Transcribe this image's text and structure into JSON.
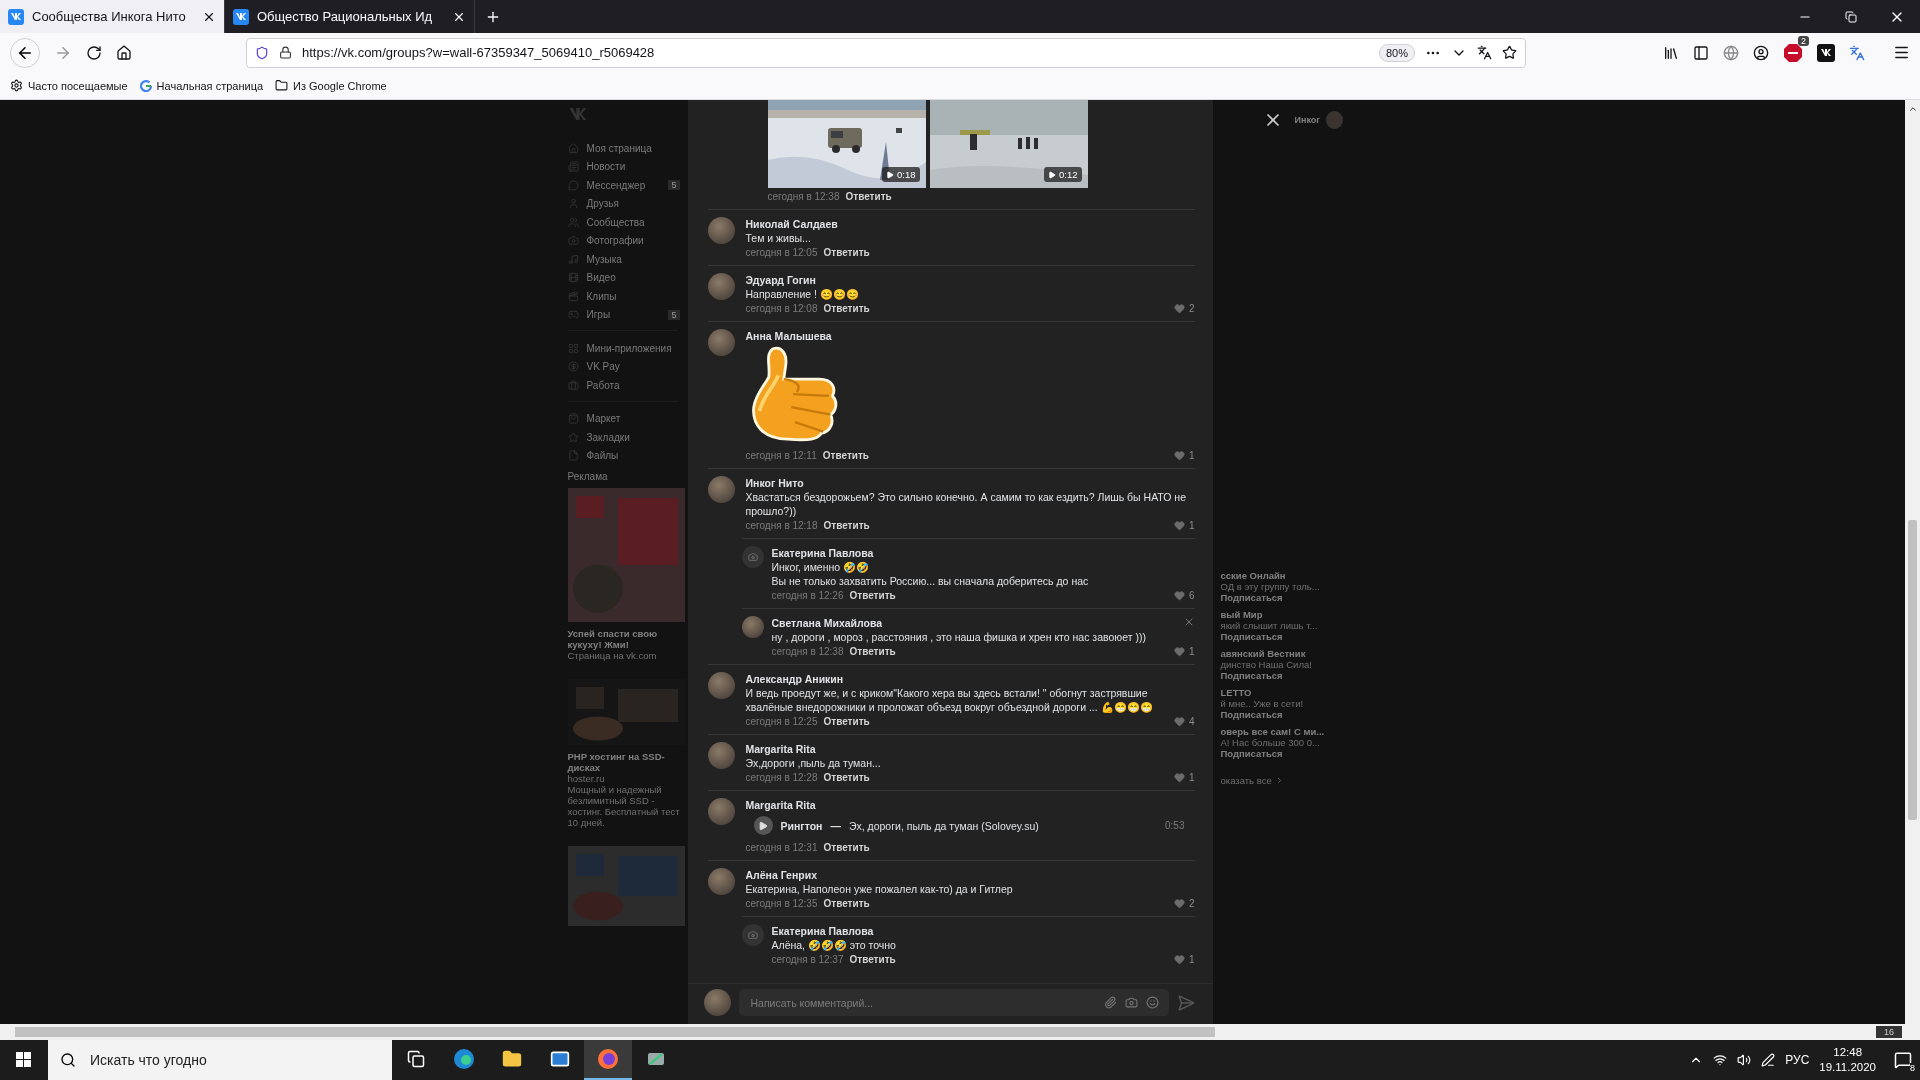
{
  "browser": {
    "tabs": [
      {
        "title": "Сообщества Инкога Нито",
        "selected": true
      },
      {
        "title": "Общество Рациональных Ид",
        "selected": false
      }
    ],
    "address": "https://vk.com/groups?w=wall-67359347_5069410_r5069428",
    "zoom": "80%",
    "adblock_badge": "2",
    "bookmarks": [
      {
        "label": "Часто посещаемые",
        "kind": "gear"
      },
      {
        "label": "Начальная страница",
        "kind": "google"
      },
      {
        "label": "Из Google Chrome",
        "kind": "folder"
      }
    ]
  },
  "sidebar": {
    "groups": [
      [
        {
          "label": "Моя страница",
          "kind": "home"
        },
        {
          "label": "Новости",
          "kind": "news"
        },
        {
          "label": "Мессенджер",
          "kind": "chat",
          "count": "5"
        },
        {
          "label": "Друзья",
          "kind": "user"
        },
        {
          "label": "Сообщества",
          "kind": "users"
        },
        {
          "label": "Фотографии",
          "kind": "camera"
        },
        {
          "label": "Музыка",
          "kind": "music"
        },
        {
          "label": "Видео",
          "kind": "video"
        },
        {
          "label": "Клипы",
          "kind": "clips"
        },
        {
          "label": "Игры",
          "kind": "games",
          "count": "5"
        }
      ],
      [
        {
          "label": "Мини-приложения",
          "kind": "apps"
        },
        {
          "label": "VK Pay",
          "kind": "pay"
        },
        {
          "label": "Работа",
          "kind": "work"
        }
      ],
      [
        {
          "label": "Маркет",
          "kind": "market"
        },
        {
          "label": "Закладки",
          "kind": "star"
        },
        {
          "label": "Файлы",
          "kind": "file"
        }
      ]
    ],
    "ads_heading": "Реклама",
    "ads": [
      {
        "kind": "picture",
        "title": "Успей спасти свою кукуху! Жми!",
        "source": "Страница на vk.com"
      },
      {
        "kind": "picture",
        "title": "PHP хостинг на SSD-дисках",
        "source": "hoster.ru",
        "description": "Мощный и надежный безлимитный SSD - хостинг. Бесплатный тест 10 дней."
      },
      {
        "kind": "picture"
      }
    ]
  },
  "right_column": {
    "user": "Инког",
    "communities": [
      {
        "name": "сские Онлайн",
        "subtitle": "ОД в эту группу толь...",
        "action": "Подписаться"
      },
      {
        "name": "вый Мир",
        "subtitle": "який слышит лишь т...",
        "action": "Подписаться"
      },
      {
        "name": "авянский Вестник",
        "subtitle": "динство Наша Сила!",
        "action": "Подписаться"
      },
      {
        "name": "LETTO",
        "subtitle": "й мне.. Уже в сети!",
        "action": "Подписаться"
      },
      {
        "name": "оверь все сам! С ми...",
        "subtitle": "А! Нас больше 300 0...",
        "action": "Подписаться"
      }
    ],
    "show_all": "оказать все"
  },
  "modal": {
    "cut_reply": {
      "videos": [
        {
          "duration": "0:18"
        },
        {
          "duration": "0:12"
        }
      ],
      "time": "сегодня в 12:38",
      "reply_label": "Ответить"
    },
    "comments": [
      {
        "author": "Николай Салдаев",
        "has_photo": true,
        "hovered": false,
        "kind": "text",
        "text": "Тем и живы...",
        "time": "сегодня в 12:05",
        "reply_label": "Ответить"
      },
      {
        "author": "Эдуард Гогин",
        "has_photo": true,
        "hovered": false,
        "kind": "text",
        "text": "Направление ! 😊😊😊",
        "time": "сегодня в 12:08",
        "reply_label": "Ответить",
        "likes": "2"
      },
      {
        "author": "Анна Малышева",
        "has_photo": true,
        "hovered": false,
        "kind": "sticker",
        "time": "сегодня в 12:11",
        "reply_label": "Ответить",
        "likes": "1"
      },
      {
        "author": "Инког Нито",
        "has_photo": true,
        "hovered": false,
        "kind": "text",
        "text": "Хвастаться бездорожьем? Это сильно конечно. А самим то как ездить? Лишь бы НАТО не прошло?))",
        "time": "сегодня в 12:18",
        "reply_label": "Ответить",
        "likes": "1",
        "replies": [
          {
            "author": "Екатерина Павлова",
            "has_photo": false,
            "hovered": false,
            "kind": "text",
            "text": "Инког, именно 🤣🤣\nВы не только захватить Россию... вы сначала доберитесь до нас",
            "time": "сегодня в 12:26",
            "reply_label": "Ответить",
            "likes": "6"
          },
          {
            "author": "Светлана Михайлова",
            "has_photo": true,
            "hovered": true,
            "kind": "text",
            "text": "ну , дороги , мороз , расстояния , это наша фишка и хрен кто нас завоюет )))",
            "time": "сегодня в 12:38",
            "reply_label": "Ответить",
            "likes": "1"
          }
        ]
      },
      {
        "author": "Александр Аникин",
        "has_photo": true,
        "hovered": false,
        "kind": "text",
        "text": "И ведь проедут же, и с криком\"Какого хера вы здесь встали! \" обогнут застрявшие хвалёные внедорожники и проложат объезд вокруг объездной дороги ... 💪😁😁😁",
        "time": "сегодня в 12:25",
        "reply_label": "Ответить",
        "likes": "4"
      },
      {
        "author": "Margarita Rita",
        "has_photo": true,
        "hovered": false,
        "kind": "text",
        "text": "Эх,дороги ,пыль да туман...",
        "time": "сегодня в 12:28",
        "reply_label": "Ответить",
        "likes": "1"
      },
      {
        "author": "Margarita Rita",
        "has_photo": true,
        "hovered": false,
        "kind": "audio",
        "audio": {
          "artist": "Рингтон",
          "separator": "—",
          "title": "Эх, дороги, пыль да туман (Solovey.su)",
          "duration": "0:53"
        },
        "time": "сегодня в 12:31",
        "reply_label": "Ответить"
      },
      {
        "author": "Алёна Генрих",
        "has_photo": true,
        "hovered": false,
        "kind": "text",
        "text": "Екатерина, Наполеон уже пожалел как-то) да и Гитлер",
        "time": "сегодня в 12:35",
        "reply_label": "Ответить",
        "likes": "2",
        "replies": [
          {
            "author": "Екатерина Павлова",
            "has_photo": false,
            "hovered": false,
            "kind": "text",
            "text": "Алёна, 🤣🤣🤣 это точно",
            "time": "сегодня в 12:37",
            "reply_label": "Ответить",
            "likes": "1"
          }
        ]
      }
    ],
    "composer": {
      "placeholder": "Написать комментарий..."
    }
  },
  "corner_counter": "16",
  "taskbar": {
    "search_placeholder": "Искать что угодно",
    "apps": [
      {
        "kind": "taskview",
        "selected": false
      },
      {
        "kind": "edge",
        "selected": false
      },
      {
        "kind": "explorer",
        "selected": false
      },
      {
        "kind": "mail",
        "selected": false
      },
      {
        "kind": "firefox",
        "selected": true
      },
      {
        "kind": "app",
        "selected": false
      }
    ],
    "language": "РУС",
    "time": "12:48",
    "date": "19.11.2020",
    "notifications": "8"
  }
}
